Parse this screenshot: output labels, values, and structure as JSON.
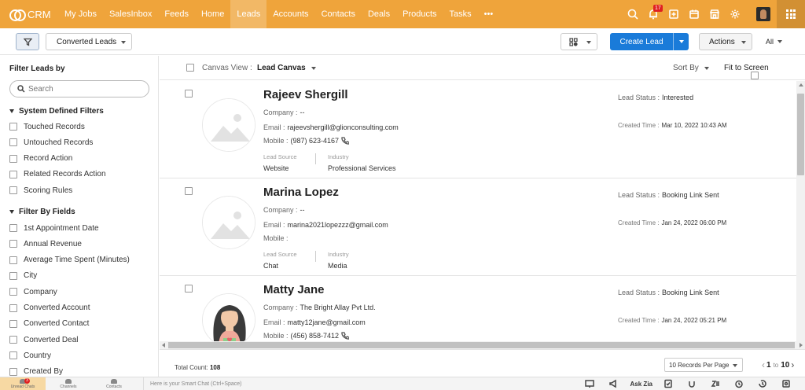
{
  "app": {
    "name": "CRM"
  },
  "nav": {
    "items": [
      "My Jobs",
      "SalesInbox",
      "Feeds",
      "Home",
      "Leads",
      "Accounts",
      "Contacts",
      "Deals",
      "Products",
      "Tasks",
      "•••"
    ],
    "active": "Leads",
    "notification_count": "17"
  },
  "toolbar": {
    "view": "Converted Leads",
    "create_label": "Create Lead",
    "actions_label": "Actions",
    "all_label": "All"
  },
  "sidebar": {
    "title": "Filter Leads by",
    "search_placeholder": "Search",
    "system_section": "System Defined Filters",
    "system_filters": [
      "Touched Records",
      "Untouched Records",
      "Record Action",
      "Related Records Action",
      "Scoring Rules"
    ],
    "field_section": "Filter By Fields",
    "field_filters": [
      "1st Appointment Date",
      "Annual Revenue",
      "Average Time Spent (Minutes)",
      "City",
      "Company",
      "Converted Account",
      "Converted Contact",
      "Converted Deal",
      "Country",
      "Created By"
    ]
  },
  "canvas": {
    "label": "Canvas View :",
    "value": "Lead Canvas",
    "sort_label": "Sort By",
    "fit_label": "Fit to Screen"
  },
  "field_labels": {
    "company": "Company :",
    "email": "Email :",
    "mobile": "Mobile :",
    "lead_source": "Lead Source",
    "industry": "Industry",
    "lead_status": "Lead Status :",
    "created_time": "Created Time :"
  },
  "leads": [
    {
      "name": "Rajeev Shergill",
      "company": "--",
      "email": "rajeevshergill@glionconsulting.com",
      "mobile": "(987) 623-4167",
      "lead_source": "Website",
      "industry": "Professional Services",
      "lead_status": "Interested",
      "created_time": "Mar 10, 2022 10:43 AM",
      "has_photo": false
    },
    {
      "name": "Marina Lopez",
      "company": "--",
      "email": "marina2021lopezzz@gmail.com",
      "mobile": "",
      "lead_source": "Chat",
      "industry": "Media",
      "lead_status": "Booking Link Sent",
      "created_time": "Jan 24, 2022 06:00 PM",
      "has_photo": false
    },
    {
      "name": "Matty Jane",
      "company": "The Bright Allay Pvt Ltd.",
      "email": "matty12jane@gmail.com",
      "mobile": "(456) 858-7412",
      "lead_source": "",
      "industry": "",
      "lead_status": "Booking Link Sent",
      "created_time": "Jan 24, 2022 05:21 PM",
      "has_photo": true
    }
  ],
  "footer": {
    "total_label": "Total Count:",
    "total_value": "108",
    "per_page": "10 Records Per Page",
    "page_from": "1",
    "page_to_label": "to",
    "page_to": "10"
  },
  "chatbar": {
    "tabs": [
      "Unread Chats",
      "Channels",
      "Contacts"
    ],
    "unread_count": "3",
    "smart_chat_placeholder": "Here is your Smart Chat (Ctrl+Space)",
    "ask_zia": "Ask Zia"
  }
}
